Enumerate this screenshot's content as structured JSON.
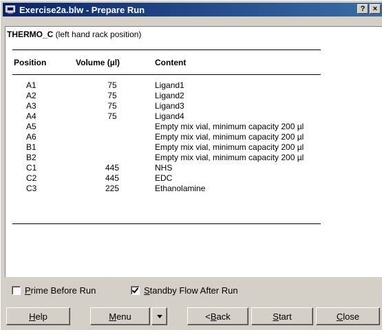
{
  "window": {
    "title": "Exercise2a.blw - Prepare Run",
    "help_glyph": "?",
    "close_glyph": "×"
  },
  "rack": {
    "name": "THERMO_C",
    "description": " (left hand rack position)"
  },
  "table": {
    "headers": [
      "Position",
      "Volume (µl)",
      "Content"
    ],
    "rows": [
      {
        "position": "A1",
        "volume": "75",
        "content": "Ligand1"
      },
      {
        "position": "A2",
        "volume": "75",
        "content": "Ligand2"
      },
      {
        "position": "A3",
        "volume": "75",
        "content": "Ligand3"
      },
      {
        "position": "A4",
        "volume": "75",
        "content": "Ligand4"
      },
      {
        "position": "A5",
        "volume": "",
        "content": "Empty mix vial, minimum capacity 200 µl"
      },
      {
        "position": "A6",
        "volume": "",
        "content": "Empty mix vial, minimum capacity 200 µl"
      },
      {
        "position": "B1",
        "volume": "",
        "content": "Empty mix vial, minimum capacity 200 µl"
      },
      {
        "position": "B2",
        "volume": "",
        "content": "Empty mix vial, minimum capacity 200 µl"
      },
      {
        "position": "C1",
        "volume": "445",
        "content": "NHS"
      },
      {
        "position": "C2",
        "volume": "445",
        "content": "EDC"
      },
      {
        "position": "C3",
        "volume": "225",
        "content": "Ethanolamine"
      }
    ]
  },
  "options": {
    "prime": {
      "first": "P",
      "rest": "rime Before Run",
      "checked": false
    },
    "standby": {
      "first": "S",
      "rest": "tandby Flow After Run",
      "checked": true
    }
  },
  "buttons": {
    "help": {
      "first": "H",
      "rest": "elp"
    },
    "menu": {
      "first": "M",
      "rest": "enu"
    },
    "back": {
      "pre": "< ",
      "first": "B",
      "rest": "ack"
    },
    "start": {
      "first": "S",
      "rest": "tart"
    },
    "close": {
      "first": "C",
      "rest": "lose"
    }
  }
}
